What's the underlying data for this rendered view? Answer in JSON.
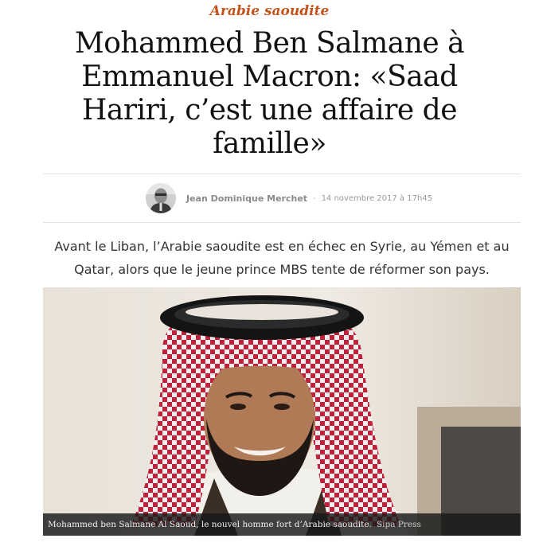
{
  "article": {
    "category": "Arabie saoudite",
    "headline": "Mohammed Ben Salmane à Emmanuel Macron: «Saad Hariri, c’est une affaire de famille»",
    "author": "Jean Dominique Merchet",
    "byline_separator": "·",
    "date": "14 novembre 2017 à 17h45",
    "lede": "Avant le Liban, l’Arabie saoudite est en échec en Syrie, au Yémen et au Qatar, alors que le jeune prince MBS tente de réformer son pays.",
    "photo": {
      "caption": "Mohammed ben Salmane Al Saoud, le nouvel homme fort d’Arabie saoudite.",
      "credit": "Sipa Press"
    }
  },
  "colors": {
    "category": "#c4541b",
    "headline": "#111111",
    "caption_bar": "#191919"
  },
  "icons": {
    "author_avatar": "author-portrait"
  }
}
